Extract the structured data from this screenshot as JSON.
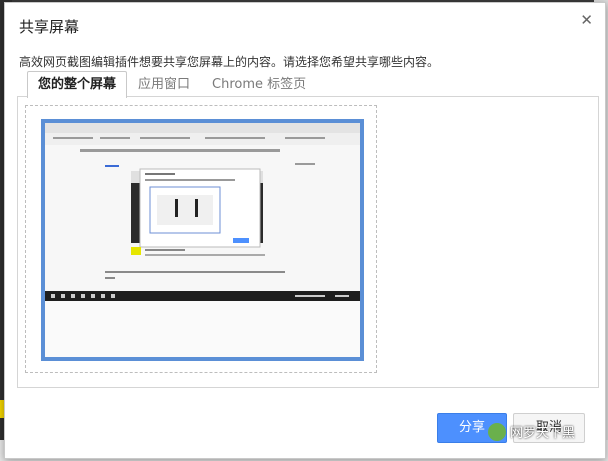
{
  "dialog": {
    "title": "共享屏幕",
    "description": "高效网页截图编辑插件想要共享您屏幕上的内容。请选择您希望共享哪些内容。",
    "tabs": [
      {
        "label": "您的整个屏幕",
        "active": true
      },
      {
        "label": "应用窗口",
        "active": false
      },
      {
        "label": "Chrome 标签页",
        "active": false
      }
    ],
    "buttons": {
      "share": "分享",
      "cancel": "取消"
    }
  },
  "icons": {
    "close": "close-icon",
    "watermark": "wechat-logo-icon"
  },
  "watermark": "网罗天下黑",
  "colors": {
    "accent": "#4d90fe",
    "selection": "#5b8fd6"
  }
}
